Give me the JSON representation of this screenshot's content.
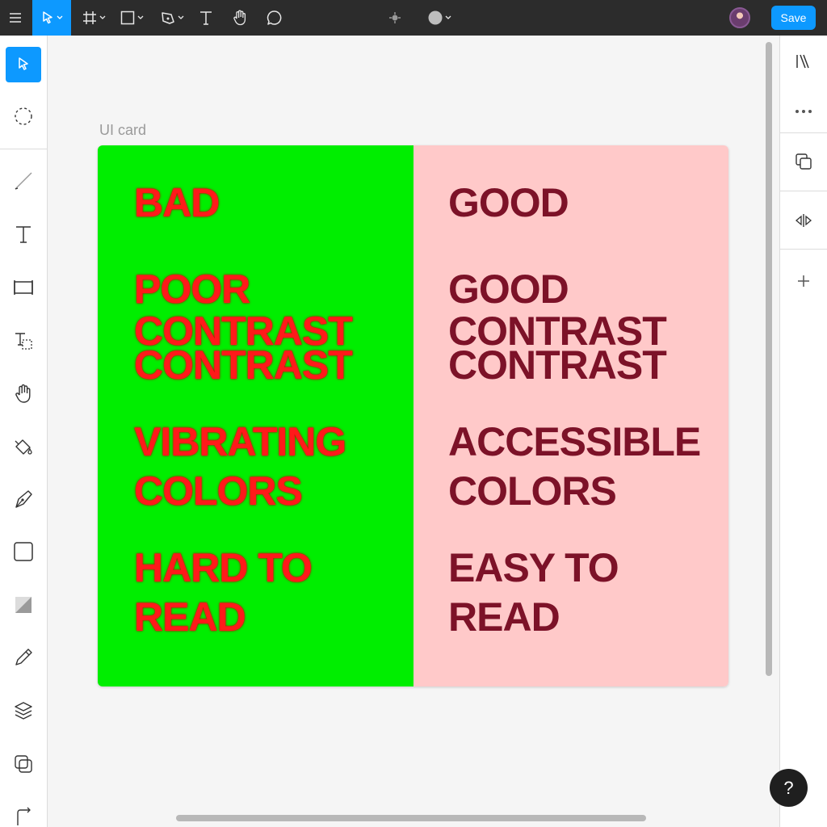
{
  "toolbar": {
    "save_label": "Save",
    "tools": [
      "menu-icon",
      "move-icon",
      "frame-icon",
      "rectangle-icon",
      "pen-icon",
      "text-icon",
      "hand-icon",
      "comment-icon",
      "component-icon",
      "fill-color-icon"
    ]
  },
  "left_tools": [
    "move-icon",
    "lasso-icon",
    "line-icon",
    "text-icon",
    "frame-icon",
    "text-box-icon",
    "hand-icon",
    "fill-bucket-icon",
    "pen-icon",
    "rectangle-icon",
    "gradient-icon",
    "pencil-icon",
    "layers-icon",
    "copy-icon",
    "crop-icon"
  ],
  "right_tools": [
    "align-icon",
    "more-icon",
    "duplicate-icon",
    "flip-icon",
    "add-icon"
  ],
  "canvas": {
    "frame_label": "UI card",
    "bad_panel": {
      "color": "#00ee00",
      "text_color": "#ff1a1a",
      "heading": "BAD",
      "line1": "POOR",
      "line2": "CONTRAST",
      "line3": "CONTRAST",
      "line4": "VIBRATING",
      "line5": "COLORS",
      "line6": "HARD TO",
      "line7": "READ"
    },
    "good_panel": {
      "color": "#ffc9c9",
      "text_color": "#7c1228",
      "heading": "GOOD",
      "line1": "GOOD",
      "line2": "CONTRAST",
      "line3": "CONTRAST",
      "line4": "ACCESSIBLE",
      "line5": "COLORS",
      "line6": "EASY TO",
      "line7": "READ"
    }
  },
  "help": {
    "label": "?"
  }
}
